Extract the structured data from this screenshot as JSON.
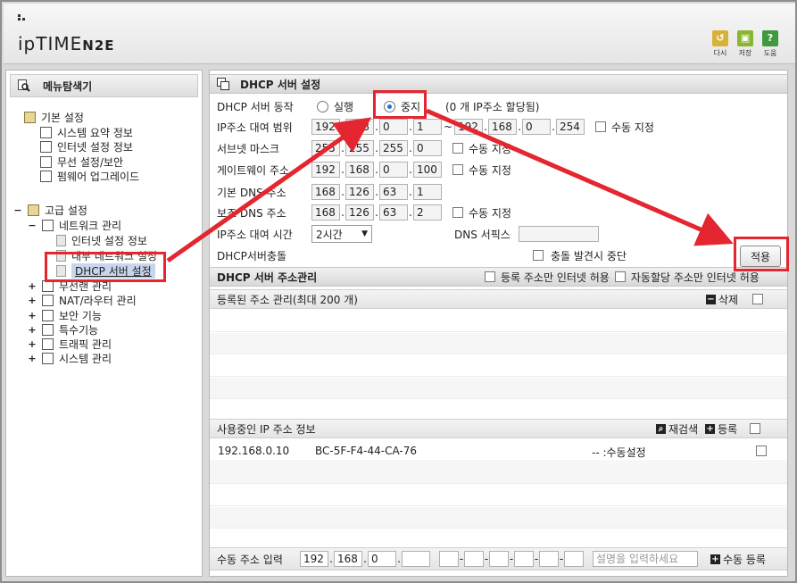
{
  "header": {
    "logo_main": "ipTIME",
    "logo_model": "N2E",
    "tools": [
      {
        "label": "다시",
        "icon": "undo-icon",
        "color": "#d7b23a",
        "glyph": "↺"
      },
      {
        "label": "저장",
        "icon": "save-icon",
        "color": "#8bb630",
        "glyph": "▣"
      },
      {
        "label": "도움",
        "icon": "help-icon",
        "color": "#3f9a3f",
        "glyph": "?"
      }
    ]
  },
  "left": {
    "title": "메뉴탐색기",
    "basic": {
      "label": "기본 설정",
      "items": [
        "시스템 요약 정보",
        "인터넷 설정 정보",
        "무선 설정/보안",
        "펌웨어 업그레이드"
      ]
    },
    "advanced": {
      "label": "고급 설정",
      "network": {
        "label": "네트워크 관리",
        "items": [
          "인터넷 설정 정보",
          "내부 네트워크 설정",
          "DHCP 서버 설정"
        ]
      },
      "groups": [
        "무선랜 관리",
        "NAT/라우터 관리",
        "보안 기능",
        "특수기능",
        "트래픽 관리",
        "시스템 관리"
      ]
    }
  },
  "right": {
    "title": "DHCP 서버 설정",
    "dhcp_action": {
      "label": "DHCP 서버 동작",
      "run": "실행",
      "stop": "중지",
      "note": "(0 개 IP주소 할당됨)"
    },
    "ip_range": {
      "label": "IP주소 대여 범위",
      "start": [
        "192",
        "168",
        "0",
        "1"
      ],
      "tilde": "~",
      "end": [
        "192",
        "168",
        "0",
        "254"
      ]
    },
    "subnet": {
      "label": "서브넷 마스크",
      "value": [
        "255",
        "255",
        "255",
        "0"
      ]
    },
    "gateway": {
      "label": "게이트웨이 주소",
      "value": [
        "192",
        "168",
        "0",
        "100"
      ]
    },
    "dns1": {
      "label": "기본 DNS 주소",
      "value": [
        "168",
        "126",
        "63",
        "1"
      ]
    },
    "dns2": {
      "label": "보조 DNS 주소",
      "value": [
        "168",
        "126",
        "63",
        "2"
      ]
    },
    "manual_label": "수동 지정",
    "lease": {
      "label": "IP주소 대여 시간",
      "value": "2시간",
      "dns_suffix_label": "DNS 서픽스"
    },
    "conflict": {
      "label": "DHCP서버충돌",
      "check_label": "충돌 발견시 중단"
    },
    "apply": "적용",
    "addr_mgmt": {
      "title": "DHCP 서버 주소관리",
      "opt1": "등록 주소만 인터넷 허용",
      "opt2": "자동할당 주소만 인터넷 허용"
    },
    "registered": {
      "label": "등록된 주소 관리(최대 200 개)",
      "delete": "삭제"
    },
    "in_use": {
      "label": "사용중인 IP 주소 정보",
      "rescan": "재검색",
      "register": "등록",
      "rows": [
        {
          "ip": "192.168.0.10",
          "mac": "BC-5F-F4-44-CA-76",
          "type": "-- :수동설정"
        }
      ]
    },
    "manual_input": {
      "label": "수동 주소 입력",
      "ip": [
        "192",
        "168",
        "0",
        ""
      ],
      "mac": [
        "",
        "",
        "",
        "",
        "",
        ""
      ],
      "desc_placeholder": "설명을 입력하세요",
      "register": "수동 등록"
    }
  },
  "accent_red": "#e3262f"
}
